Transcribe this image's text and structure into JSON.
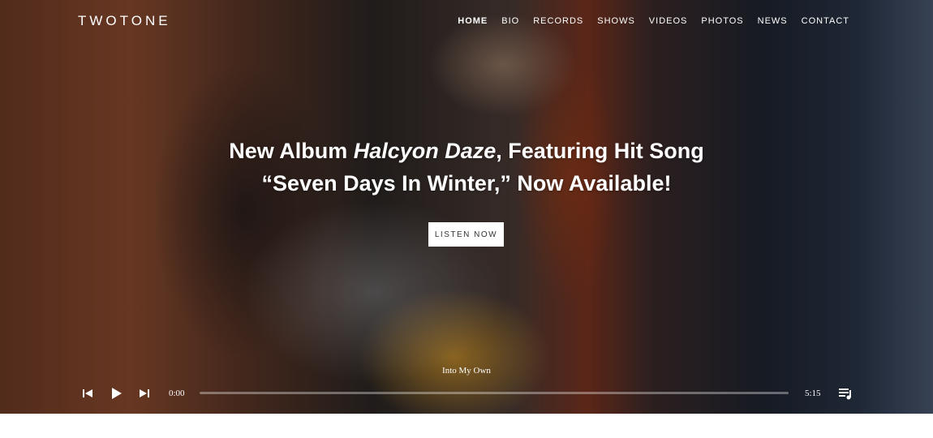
{
  "site": {
    "logo": "TWOTONE"
  },
  "nav": {
    "items": [
      {
        "label": "HOME"
      },
      {
        "label": "BIO"
      },
      {
        "label": "RECORDS"
      },
      {
        "label": "SHOWS"
      },
      {
        "label": "VIDEOS"
      },
      {
        "label": "PHOTOS"
      },
      {
        "label": "NEWS"
      },
      {
        "label": "CONTACT"
      }
    ],
    "active": "HOME"
  },
  "hero": {
    "headline_line1_prefix": "New Album ",
    "headline_line1_album": "Halcyon Daze",
    "headline_line1_suffix": ", Featuring Hit Song",
    "headline_line2": "“Seven Days In Winter,” Now Available!",
    "cta_label": "LISTEN NOW"
  },
  "player": {
    "track_title": "Into My Own",
    "current_time": "0:00",
    "duration": "5:15",
    "progress": 0,
    "icons": {
      "previous": "skip-previous-icon",
      "play": "play-icon",
      "next": "skip-next-icon",
      "playlist": "playlist-icon"
    }
  },
  "colors": {
    "text": "#ffffff",
    "button_bg": "#ffffff",
    "button_text": "#333333"
  }
}
